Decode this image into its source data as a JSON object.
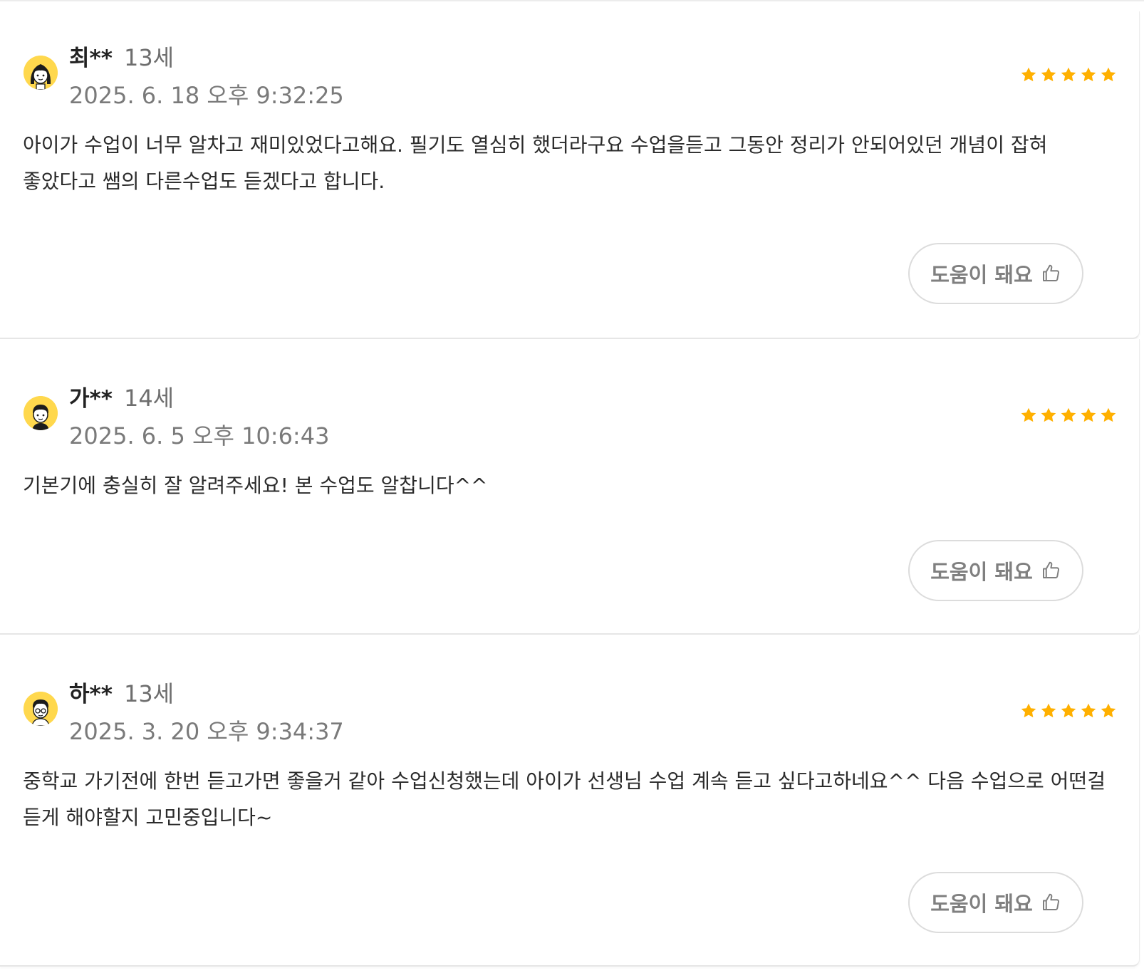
{
  "reviews": [
    {
      "name": "최**",
      "age": "13세",
      "date": "2025. 6. 18 오후 9:32:25",
      "rating": 5,
      "text": "아이가 수업이 너무 알차고 재미있었다고해요. 필기도 열심히 했더라구요 수업을듣고 그동안 정리가 안되어있던 개념이 잡혀 좋았다고 쌤의 다른수업도 듣겠다고 합니다.",
      "helpful_label": "도움이 돼요",
      "avatar_icon": "girl-avatar-icon"
    },
    {
      "name": "가**",
      "age": "14세",
      "date": "2025. 6. 5 오후 10:6:43",
      "rating": 5,
      "text": "기본기에 충실히 잘 알려주세요! 본 수업도 알찹니다^^",
      "helpful_label": "도움이 돼요",
      "avatar_icon": "boy-avatar-icon"
    },
    {
      "name": "하**",
      "age": "13세",
      "date": "2025. 3. 20 오후 9:34:37",
      "rating": 5,
      "text": "중학교 가기전에 한번 듣고가면 좋을거 같아 수업신청했는데 아이가 선생님 수업 계속 듣고 싶다고하네요^^ 다음 수업으로 어떤걸 듣게 해야할지 고민중입니다~",
      "helpful_label": "도움이 돼요",
      "avatar_icon": "glasses-boy-avatar-icon"
    }
  ],
  "colors": {
    "star": "#ffb000",
    "avatar_bg": "#ffd84d",
    "border": "#dcdcdc"
  }
}
